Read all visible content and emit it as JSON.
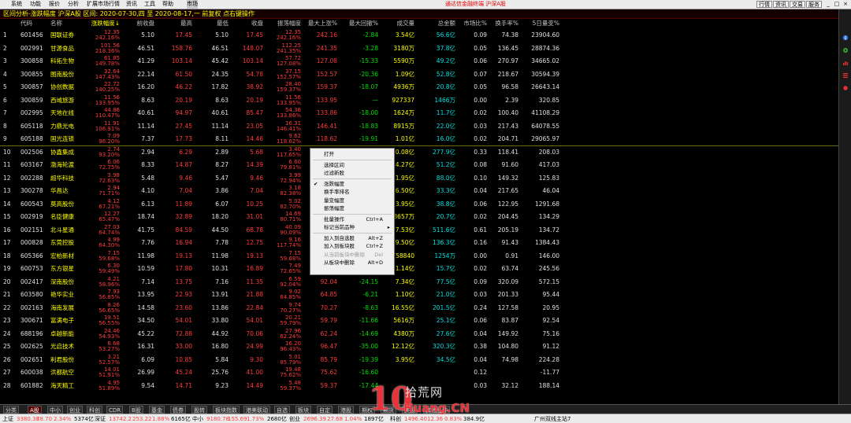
{
  "menu": {
    "items": [
      "系统",
      "功能",
      "报价",
      "分析",
      "扩展市场行情",
      "资讯",
      "工具",
      "帮助",
      "市场"
    ],
    "active_index": 8,
    "brand": "通达信金融终端 沪深A股",
    "right_buttons": [
      "行情",
      "资讯",
      "交易",
      "服务"
    ]
  },
  "title": {
    "label": "区间分析-涨跌幅度 沪深A股",
    "period_label": "区间: 2020-07-30,四 至 2020-08-17,一",
    "mode": "前复权",
    "hint": "点右键操作"
  },
  "table": {
    "headers": [
      "代码",
      "名称",
      "涨跌幅度↓",
      "前收盘",
      "最高",
      "最低",
      "收盘",
      "振荡幅度",
      "最大上涨%",
      "最大回撤%",
      "成交量",
      "总金额",
      "市场比%",
      "换手率%",
      "5日量变%"
    ],
    "rows": [
      {
        "no": "1",
        "code": "601456",
        "name": "国联证券",
        "chg_price": "12.35",
        "chg_pct": "242.16%",
        "prev": "5.10",
        "high": "17.45",
        "low": "5.10",
        "close": "17.45",
        "amp": "12.35",
        "amp_pct": "242.16%",
        "max_up": "242.16",
        "max_dd": "-2.84",
        "vol": "3.54亿",
        "amount": "56.6亿",
        "mkt": "0.09",
        "turn": "74.38",
        "v5": "23904.60"
      },
      {
        "no": "2",
        "code": "002991",
        "name": "甘源食品",
        "chg_price": "101.56",
        "chg_pct": "218.36%",
        "prev": "46.51",
        "high": "158.76",
        "low": "46.51",
        "close": "148.07",
        "amp": "112.25",
        "amp_pct": "241.35%",
        "max_up": "241.35",
        "max_dd": "-3.28",
        "vol": "3180万",
        "amount": "37.8亿",
        "mkt": "0.05",
        "turn": "136.45",
        "v5": "28874.36"
      },
      {
        "no": "3",
        "code": "300858",
        "name": "科拓生物",
        "chg_price": "61.85",
        "chg_pct": "149.78%",
        "prev": "41.29",
        "high": "103.14",
        "low": "45.42",
        "close": "103.14",
        "amp": "57.72",
        "amp_pct": "127.08%",
        "max_up": "127.08",
        "max_dd": "-15.33",
        "vol": "5590万",
        "amount": "49.2亿",
        "mkt": "0.06",
        "turn": "270.97",
        "v5": "34665.02"
      },
      {
        "no": "4",
        "code": "300855",
        "name": "图南股份",
        "chg_price": "32.64",
        "chg_pct": "147.43%",
        "prev": "22.14",
        "high": "61.50",
        "low": "24.35",
        "close": "54.78",
        "amp": "37.15",
        "amp_pct": "152.57%",
        "max_up": "152.57",
        "max_dd": "-20.36",
        "vol": "1.09亿",
        "amount": "52.8亿",
        "mkt": "0.07",
        "turn": "218.67",
        "v5": "30594.39"
      },
      {
        "no": "5",
        "code": "300857",
        "name": "协创数据",
        "chg_price": "22.72",
        "chg_pct": "140.25%",
        "prev": "16.20",
        "high": "46.22",
        "low": "17.82",
        "close": "38.92",
        "amp": "28.40",
        "amp_pct": "159.37%",
        "max_up": "159.37",
        "max_dd": "-18.07",
        "vol": "4936万",
        "amount": "20.8亿",
        "mkt": "0.05",
        "turn": "96.58",
        "v5": "26643.14"
      },
      {
        "no": "6",
        "code": "300859",
        "name": "西域旅游",
        "chg_price": "11.56",
        "chg_pct": "133.95%",
        "prev": "8.63",
        "high": "20.19",
        "low": "8.63",
        "close": "20.19",
        "amp": "11.56",
        "amp_pct": "133.95%",
        "max_up": "133.95",
        "max_dd": "—",
        "vol": "927337",
        "amount": "1466万",
        "mkt": "0.00",
        "turn": "2.39",
        "v5": "320.85"
      },
      {
        "no": "7",
        "code": "002995",
        "name": "天地在线",
        "chg_price": "44.86",
        "chg_pct": "110.47%",
        "prev": "40.61",
        "high": "94.97",
        "low": "40.61",
        "close": "85.47",
        "amp": "54.36",
        "amp_pct": "133.86%",
        "max_up": "133.86",
        "max_dd": "-18.00",
        "vol": "1624万",
        "amount": "11.7亿",
        "mkt": "0.02",
        "turn": "100.40",
        "v5": "41108.29"
      },
      {
        "no": "8",
        "code": "605118",
        "name": "力鼎光电",
        "chg_price": "11.91",
        "chg_pct": "106.91%",
        "prev": "11.14",
        "high": "27.45",
        "low": "11.14",
        "close": "23.05",
        "amp": "16.31",
        "amp_pct": "146.41%",
        "max_up": "146.41",
        "max_dd": "-18.83",
        "vol": "8915万",
        "amount": "22.0亿",
        "mkt": "0.03",
        "turn": "217.43",
        "v5": "64078.55"
      },
      {
        "no": "9",
        "code": "605188",
        "name": "国光连锁",
        "chg_price": "7.09",
        "chg_pct": "96.20%",
        "prev": "7.37",
        "high": "17.73",
        "low": "8.11",
        "close": "14.46",
        "amp": "9.62",
        "amp_pct": "118.62%",
        "max_up": "118.62",
        "max_dd": "-19.91",
        "vol": "1.01亿",
        "amount": "16.0亿",
        "mkt": "0.02",
        "turn": "204.71",
        "v5": "29065.97"
      },
      {
        "no": "10",
        "code": "002506",
        "name": "协鑫集成",
        "chg_price": "2.74",
        "chg_pct": "93.20%",
        "prev": "2.94",
        "high": "6.29",
        "low": "2.89",
        "close": "5.68",
        "amp": "3.40",
        "amp_pct": "117.65%",
        "max_up": "",
        "max_dd": "",
        "vol": "50.08亿",
        "amount": "277.9亿",
        "mkt": "0.33",
        "turn": "118.41",
        "v5": "208.03"
      },
      {
        "no": "11",
        "code": "603167",
        "name": "渤海轮渡",
        "chg_price": "6.06",
        "chg_pct": "72.75%",
        "prev": "8.33",
        "high": "14.87",
        "low": "8.27",
        "close": "14.39",
        "amp": "6.60",
        "amp_pct": "79.81%",
        "max_up": "",
        "max_dd": "",
        "vol": "4.27亿",
        "amount": "51.2亿",
        "mkt": "0.08",
        "turn": "91.60",
        "v5": "417.03"
      },
      {
        "no": "12",
        "code": "002288",
        "name": "超华科技",
        "chg_price": "3.98",
        "chg_pct": "72.63%",
        "prev": "5.48",
        "high": "9.46",
        "low": "5.47",
        "close": "9.46",
        "amp": "3.99",
        "amp_pct": "72.94%",
        "max_up": "",
        "max_dd": "",
        "vol": "11.95亿",
        "amount": "88.0亿",
        "mkt": "0.10",
        "turn": "149.32",
        "v5": "125.83"
      },
      {
        "no": "13",
        "code": "300278",
        "name": "华昌达",
        "chg_price": "2.94",
        "chg_pct": "71.71%",
        "prev": "4.10",
        "high": "7.04",
        "low": "3.86",
        "close": "7.04",
        "amp": "3.18",
        "amp_pct": "82.38%",
        "max_up": "",
        "max_dd": "",
        "vol": "6.50亿",
        "amount": "33.3亿",
        "mkt": "0.04",
        "turn": "217.65",
        "v5": "46.04"
      },
      {
        "no": "14",
        "code": "600543",
        "name": "莫高股份",
        "chg_price": "4.12",
        "chg_pct": "67.21%",
        "prev": "6.13",
        "high": "11.89",
        "low": "6.07",
        "close": "10.25",
        "amp": "5.02",
        "amp_pct": "82.70%",
        "max_up": "",
        "max_dd": "",
        "vol": "3.95亿",
        "amount": "38.8亿",
        "mkt": "0.06",
        "turn": "122.95",
        "v5": "1291.68"
      },
      {
        "no": "15",
        "code": "002919",
        "name": "名臣健康",
        "chg_price": "12.27",
        "chg_pct": "65.47%",
        "prev": "18.74",
        "high": "32.89",
        "low": "18.20",
        "close": "31.01",
        "amp": "14.69",
        "amp_pct": "80.71%",
        "max_up": "",
        "max_dd": "",
        "vol": "8657万",
        "amount": "20.7亿",
        "mkt": "0.02",
        "turn": "204.45",
        "v5": "134.29"
      },
      {
        "no": "16",
        "code": "002151",
        "name": "北斗星通",
        "chg_price": "27.03",
        "chg_pct": "64.74%",
        "prev": "41.75",
        "high": "84.59",
        "low": "44.50",
        "close": "68.78",
        "amp": "40.09",
        "amp_pct": "90.09%",
        "max_up": "",
        "max_dd": "",
        "vol": "7.53亿",
        "amount": "511.6亿",
        "mkt": "0.61",
        "turn": "205.19",
        "v5": "134.72"
      },
      {
        "no": "17",
        "code": "000828",
        "name": "东莞控股",
        "chg_price": "4.99",
        "chg_pct": "64.30%",
        "prev": "7.76",
        "high": "16.94",
        "low": "7.78",
        "close": "12.75",
        "amp": "9.16",
        "amp_pct": "117.74%",
        "max_up": "",
        "max_dd": "",
        "vol": "9.50亿",
        "amount": "136.3亿",
        "mkt": "0.16",
        "turn": "91.43",
        "v5": "1384.43"
      },
      {
        "no": "18",
        "code": "605366",
        "name": "宏柏新材",
        "chg_price": "7.15",
        "chg_pct": "59.68%",
        "prev": "11.98",
        "high": "19.13",
        "low": "11.98",
        "close": "19.13",
        "amp": "7.15",
        "amp_pct": "59.68%",
        "max_up": "",
        "max_dd": "",
        "vol": "758840",
        "amount": "1254万",
        "mkt": "0.00",
        "turn": "0.91",
        "v5": "146.00"
      },
      {
        "no": "19",
        "code": "600753",
        "name": "东方银星",
        "chg_price": "6.30",
        "chg_pct": "59.49%",
        "prev": "10.59",
        "high": "17.80",
        "low": "10.31",
        "close": "16.89",
        "amp": "7.49",
        "amp_pct": "72.65%",
        "max_up": "72.65",
        "max_dd": "-9.66",
        "vol": "1.14亿",
        "amount": "15.7亿",
        "mkt": "0.02",
        "turn": "63.74",
        "v5": "245.56"
      },
      {
        "no": "20",
        "code": "002417",
        "name": "深南股份",
        "chg_price": "4.21",
        "chg_pct": "58.96%",
        "prev": "7.14",
        "high": "13.75",
        "low": "7.16",
        "close": "11.35",
        "amp": "6.59",
        "amp_pct": "92.04%",
        "max_up": "92.04",
        "max_dd": "-24.15",
        "vol": "7.34亿",
        "amount": "77.5亿",
        "mkt": "0.09",
        "turn": "320.09",
        "v5": "572.15"
      },
      {
        "no": "21",
        "code": "603580",
        "name": "艳华实业",
        "chg_price": "7.93",
        "chg_pct": "56.85%",
        "prev": "13.95",
        "high": "22.93",
        "low": "13.91",
        "close": "21.88",
        "amp": "9.02",
        "amp_pct": "64.85%",
        "max_up": "64.85",
        "max_dd": "-6.21",
        "vol": "1.10亿",
        "amount": "21.0亿",
        "mkt": "0.03",
        "turn": "201.33",
        "v5": "95.44"
      },
      {
        "no": "22",
        "code": "002163",
        "name": "海南发展",
        "chg_price": "8.26",
        "chg_pct": "56.65%",
        "prev": "14.58",
        "high": "23.60",
        "low": "13.86",
        "close": "22.84",
        "amp": "9.74",
        "amp_pct": "70.27%",
        "max_up": "70.27",
        "max_dd": "-8.63",
        "vol": "16.55亿",
        "amount": "201.5亿",
        "mkt": "0.24",
        "turn": "127.58",
        "v5": "20.95"
      },
      {
        "no": "23",
        "code": "300671",
        "name": "富满电子",
        "chg_price": "19.51",
        "chg_pct": "56.55%",
        "prev": "34.50",
        "high": "54.01",
        "low": "33.80",
        "close": "54.01",
        "amp": "20.21",
        "amp_pct": "59.79%",
        "max_up": "59.79",
        "max_dd": "-11.66",
        "vol": "5616万",
        "amount": "25.1亿",
        "mkt": "0.06",
        "turn": "83.87",
        "v5": "92.54"
      },
      {
        "no": "24",
        "code": "688196",
        "name": "卓越新能",
        "chg_price": "24.46",
        "chg_pct": "54.93%",
        "prev": "45.22",
        "high": "72.88",
        "low": "44.92",
        "close": "70.06",
        "amp": "27.96",
        "amp_pct": "62.24%",
        "max_up": "62.24",
        "max_dd": "-14.69",
        "vol": "4380万",
        "amount": "27.6亿",
        "mkt": "0.04",
        "turn": "149.92",
        "v5": "75.16"
      },
      {
        "no": "25",
        "code": "002625",
        "name": "光启技术",
        "chg_price": "8.68",
        "chg_pct": "53.27%",
        "prev": "16.31",
        "high": "33.00",
        "low": "16.80",
        "close": "24.99",
        "amp": "16.20",
        "amp_pct": "96.43%",
        "max_up": "96.47",
        "max_dd": "-35.00",
        "vol": "12.12亿",
        "amount": "320.3亿",
        "mkt": "0.38",
        "turn": "104.80",
        "v5": "91.12"
      },
      {
        "no": "26",
        "code": "002651",
        "name": "利君股份",
        "chg_price": "3.21",
        "chg_pct": "52.57%",
        "prev": "6.09",
        "high": "10.85",
        "low": "5.84",
        "close": "9.30",
        "amp": "5.01",
        "amp_pct": "85.79%",
        "max_up": "85.79",
        "max_dd": "-19.39",
        "vol": "3.95亿",
        "amount": "34.5亿",
        "mkt": "0.04",
        "turn": "74.98",
        "v5": "224.28"
      },
      {
        "no": "27",
        "code": "600038",
        "name": "洪都航空",
        "chg_price": "14.01",
        "chg_pct": "51.91%",
        "prev": "26.99",
        "high": "45.24",
        "low": "25.76",
        "close": "41.00",
        "amp": "19.48",
        "amp_pct": "75.62%",
        "max_up": "75.62",
        "max_dd": "-16.60",
        "vol": "",
        "amount": "",
        "mkt": "0.12",
        "turn": "",
        "v5": "-11.77"
      },
      {
        "no": "28",
        "code": "601882",
        "name": "海天精工",
        "chg_price": "4.95",
        "chg_pct": "51.89%",
        "prev": "9.54",
        "high": "14.71",
        "low": "9.23",
        "close": "14.49",
        "amp": "5.48",
        "amp_pct": "59.37%",
        "max_up": "59.37",
        "max_dd": "-17.44",
        "vol": "",
        "amount": "",
        "mkt": "0.03",
        "turn": "32.12",
        "v5": "188.14"
      }
    ]
  },
  "context_menu": {
    "items": [
      {
        "label": "打开",
        "shortcut": "",
        "checked": false,
        "disabled": false,
        "submenu": false
      },
      {
        "label": "选择区间",
        "shortcut": "",
        "checked": false,
        "disabled": false,
        "submenu": false
      },
      {
        "label": "过滤新股",
        "shortcut": "",
        "checked": false,
        "disabled": false,
        "submenu": false
      },
      {
        "label": "涨跌幅度",
        "shortcut": "",
        "checked": true,
        "disabled": false,
        "submenu": false
      },
      {
        "label": "换手率排名",
        "shortcut": "",
        "checked": false,
        "disabled": false,
        "submenu": false
      },
      {
        "label": "量变幅度",
        "shortcut": "",
        "checked": false,
        "disabled": false,
        "submenu": false
      },
      {
        "label": "振荡幅度",
        "shortcut": "",
        "checked": false,
        "disabled": false,
        "submenu": false
      },
      {
        "label": "批量操作",
        "shortcut": "Ctrl+A",
        "checked": false,
        "disabled": false,
        "submenu": false
      },
      {
        "label": "标记当前品种",
        "shortcut": "",
        "checked": false,
        "disabled": false,
        "submenu": true
      },
      {
        "label": "加入到自选股",
        "shortcut": "Alt+Z",
        "checked": false,
        "disabled": false,
        "submenu": false
      },
      {
        "label": "加入到板块股",
        "shortcut": "Ctrl+Z",
        "checked": false,
        "disabled": false,
        "submenu": false
      },
      {
        "label": "从当前板块中删除",
        "shortcut": "Del",
        "checked": false,
        "disabled": true,
        "submenu": false
      },
      {
        "label": "从板块中删除",
        "shortcut": "Alt+D",
        "checked": false,
        "disabled": false,
        "submenu": false
      }
    ]
  },
  "bottom_tabs": [
    "分类",
    "A股",
    "中小",
    "创业",
    "科创",
    "CDR",
    "B股",
    "基金",
    "债券",
    "股转",
    "板块指数",
    "港美联动",
    "自选",
    "板块",
    "自定",
    "港股",
    "期权",
    "期货",
    "美股",
    "其他品种"
  ],
  "bottom_active_index": 1,
  "status": {
    "sh_label": "上证",
    "sh_val": "3380.38",
    "sh_chg": "78.70",
    "sh_pct": "2.34%",
    "sh_amt": "5374亿",
    "sz_label": "深证",
    "sz_val": "13742.2",
    "sz_chg": "253.22",
    "sz_pct": "1.88%",
    "sz_amt": "6165亿",
    "zx_label": "中小",
    "zx_val": "9180.78",
    "zx_chg": "155.69",
    "zx_pct": "1.73%",
    "zx_amt": "2680亿",
    "cy_label": "创业",
    "cy_val": "2696.39",
    "cy_chg": "27.68",
    "cy_pct": "1.04%",
    "cy_amt": "1897亿",
    "kc_label": "科创",
    "kc_val": "1496.40",
    "kc_chg": "12.36",
    "kc_pct": "0.83%",
    "kc_amt": "384.9亿",
    "server": "广州双线主站7"
  },
  "watermark": {
    "logo": "10",
    "top": "拾荒网",
    "bottom": "Huang.CN"
  },
  "colors": {
    "up": "#ff3c3c",
    "down": "#00e000",
    "neutral": "#e0e0e0",
    "accent": "#ffff00",
    "volume": "#ffff00",
    "amount": "#00e0e0"
  },
  "icons": [
    "info-icon",
    "gear-icon",
    "chart-icon",
    "list-icon",
    "dot-icon"
  ]
}
